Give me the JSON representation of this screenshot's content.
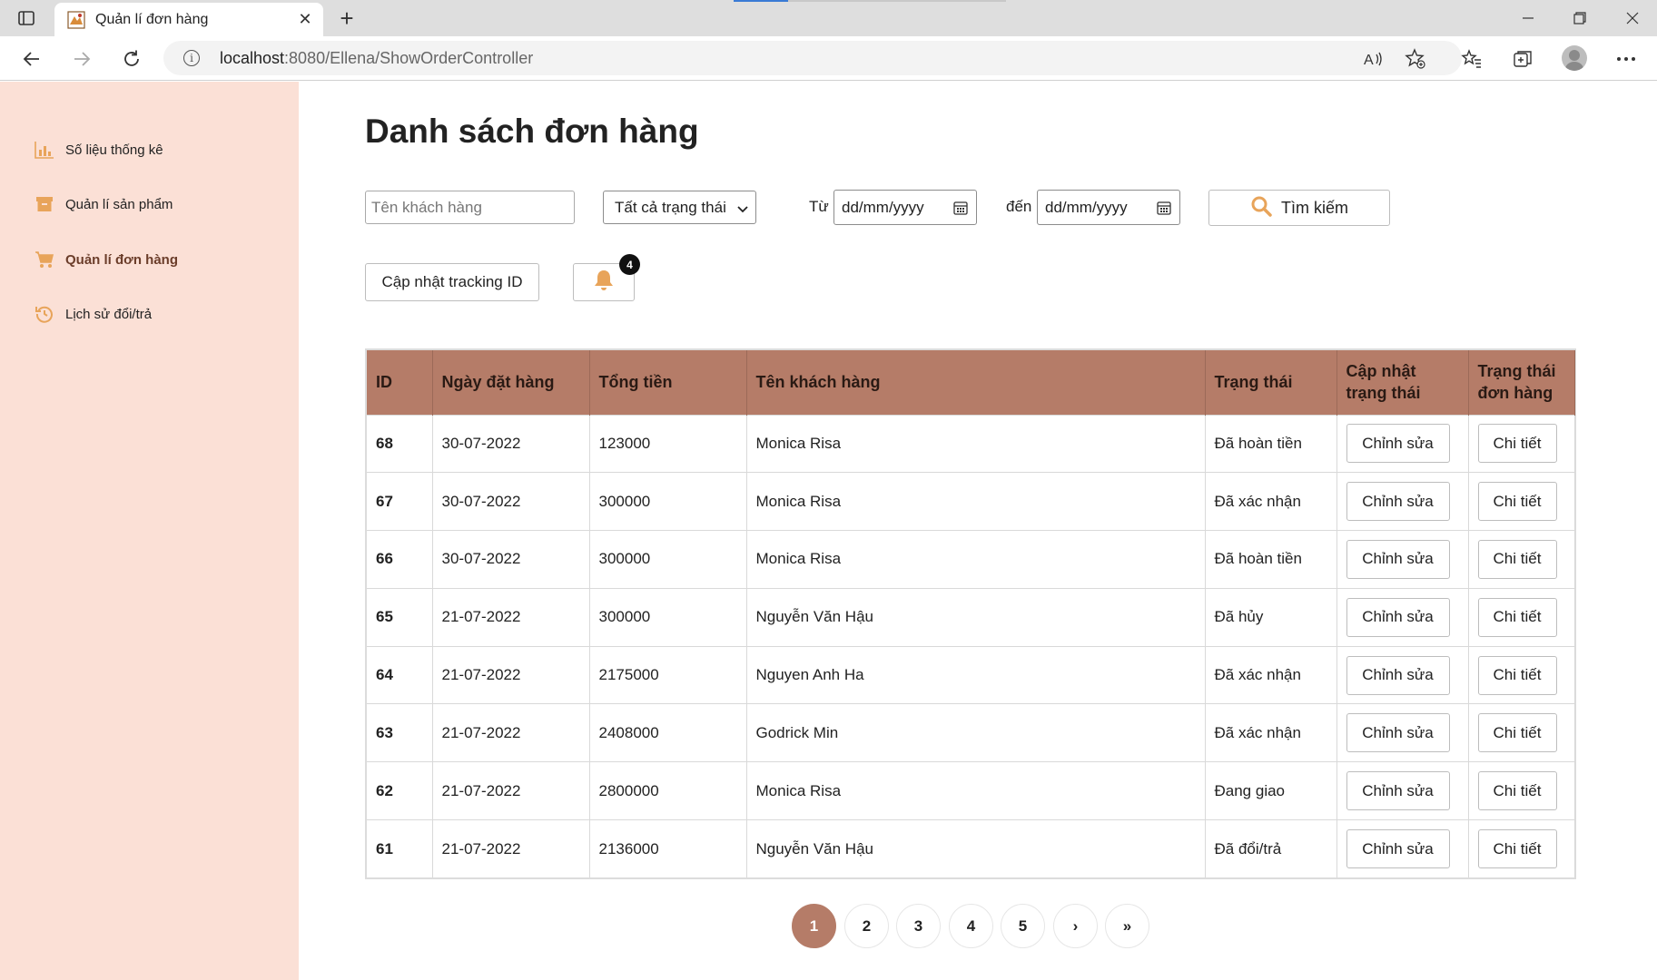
{
  "browser": {
    "tab_title": "Quản lí đơn hàng",
    "url_host": "localhost",
    "url_path": ":8080/Ellena/ShowOrderController"
  },
  "sidebar": {
    "items": [
      {
        "label": "Số liệu thống kê",
        "icon": "bar-chart-icon"
      },
      {
        "label": "Quản lí sản phẩm",
        "icon": "box-icon"
      },
      {
        "label": "Quản lí đơn hàng",
        "icon": "cart-icon",
        "active": true
      },
      {
        "label": "Lịch sử đổi/trả",
        "icon": "history-icon"
      }
    ]
  },
  "main": {
    "title": "Danh sách đơn hàng",
    "filters": {
      "customer_placeholder": "Tên khách hàng",
      "status_selected": "Tất cả trạng thái",
      "from_label": "Từ",
      "from_placeholder": "dd/mm/yyyy",
      "to_label": "đến",
      "to_placeholder": "dd/mm/yyyy",
      "search_label": "Tìm kiếm"
    },
    "tracking_button": "Cập nhật tracking ID",
    "notification_count": "4"
  },
  "table": {
    "headers": [
      "ID",
      "Ngày đặt hàng",
      "Tổng tiền",
      "Tên khách hàng",
      "Trạng thái",
      "Cập nhật trạng thái",
      "Trạng thái đơn hàng"
    ],
    "edit_label": "Chỉnh sửa",
    "detail_label": "Chi tiết",
    "rows": [
      {
        "id": "68",
        "date": "30-07-2022",
        "total": "123000",
        "customer": "Monica Risa",
        "status": "Đã hoàn tiền"
      },
      {
        "id": "67",
        "date": "30-07-2022",
        "total": "300000",
        "customer": "Monica Risa",
        "status": "Đã xác nhận"
      },
      {
        "id": "66",
        "date": "30-07-2022",
        "total": "300000",
        "customer": "Monica Risa",
        "status": "Đã hoàn tiền"
      },
      {
        "id": "65",
        "date": "21-07-2022",
        "total": "300000",
        "customer": "Nguyễn Văn Hậu",
        "status": "Đã hủy"
      },
      {
        "id": "64",
        "date": "21-07-2022",
        "total": "2175000",
        "customer": "Nguyen Anh Ha",
        "status": "Đã xác nhận"
      },
      {
        "id": "63",
        "date": "21-07-2022",
        "total": "2408000",
        "customer": "Godrick Min",
        "status": "Đã xác nhận"
      },
      {
        "id": "62",
        "date": "21-07-2022",
        "total": "2800000",
        "customer": "Monica Risa",
        "status": "Đang giao"
      },
      {
        "id": "61",
        "date": "21-07-2022",
        "total": "2136000",
        "customer": "Nguyễn Văn Hậu",
        "status": "Đã đổi/trả"
      }
    ]
  },
  "pagination": {
    "pages": [
      "1",
      "2",
      "3",
      "4",
      "5"
    ],
    "active": "1",
    "next": "›",
    "last": "»"
  },
  "colors": {
    "sidebar_bg": "#fbe0d6",
    "accent": "#b57c68",
    "icon_orange": "#e8a45a"
  }
}
